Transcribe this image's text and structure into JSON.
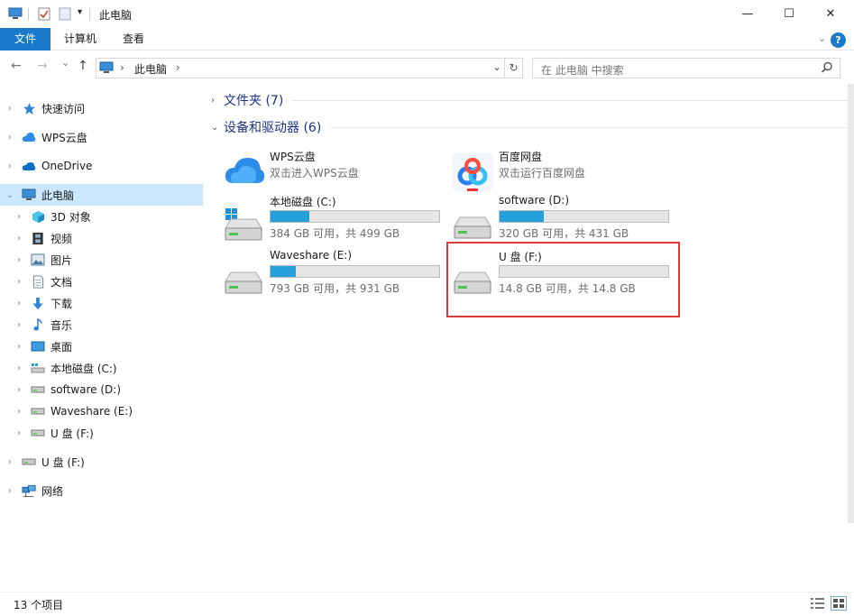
{
  "window": {
    "title": "此电脑",
    "minimize_glyph": "—",
    "maximize_glyph": "☐",
    "close_glyph": "✕"
  },
  "ribbon": {
    "tabs": [
      "文件",
      "计算机",
      "查看"
    ],
    "help": "?",
    "accent": "#1979ca"
  },
  "nav": {
    "back": "←",
    "forward": "→",
    "recent": "⌄",
    "up": "↑",
    "breadcrumb_root": "此电脑",
    "breadcrumb_sep": "›",
    "dropdown": "⌄",
    "refresh": "↻",
    "search_placeholder": "在 此电脑 中搜索"
  },
  "sidebar": {
    "items": [
      {
        "label": "快速访问",
        "icon": "star-icon",
        "chevron": "›"
      },
      {
        "label": "WPS云盘",
        "icon": "cloud-icon",
        "chevron": "›"
      },
      {
        "label": "OneDrive",
        "icon": "onedrive-icon",
        "chevron": "›"
      },
      {
        "label": "此电脑",
        "icon": "computer-icon",
        "chevron": "⌄"
      },
      {
        "label": "3D 对象",
        "icon": "cube-icon",
        "chevron": "›"
      },
      {
        "label": "视频",
        "icon": "film-icon",
        "chevron": "›"
      },
      {
        "label": "图片",
        "icon": "picture-icon",
        "chevron": "›"
      },
      {
        "label": "文档",
        "icon": "document-icon",
        "chevron": "›"
      },
      {
        "label": "下载",
        "icon": "download-icon",
        "chevron": "›"
      },
      {
        "label": "音乐",
        "icon": "music-icon",
        "chevron": "›"
      },
      {
        "label": "桌面",
        "icon": "desktop-icon",
        "chevron": "›"
      },
      {
        "label": "本地磁盘 (C:)",
        "icon": "system-drive-icon",
        "chevron": "›"
      },
      {
        "label": "software (D:)",
        "icon": "drive-icon",
        "chevron": "›"
      },
      {
        "label": "Waveshare (E:)",
        "icon": "drive-icon",
        "chevron": "›"
      },
      {
        "label": "U 盘 (F:)",
        "icon": "drive-icon",
        "chevron": "›"
      },
      {
        "label": "U 盘 (F:)",
        "icon": "drive-icon",
        "chevron": "›"
      },
      {
        "label": "网络",
        "icon": "network-icon",
        "chevron": "›"
      }
    ]
  },
  "groups": {
    "folders": {
      "label": "文件夹 (7)",
      "chevron": "›"
    },
    "devices": {
      "label": "设备和驱动器 (6)",
      "chevron": "⌄"
    }
  },
  "devices": [
    {
      "name": "WPS云盘",
      "subtitle": "双击进入WPS云盘",
      "icon": "wps-cloud-icon"
    },
    {
      "name": "百度网盘",
      "subtitle": "双击运行百度网盘",
      "icon": "baidu-netdisk-icon"
    },
    {
      "name": "本地磁盘 (C:)",
      "subtitle": "384 GB 可用，共 499 GB",
      "used_fraction": 0.23,
      "icon": "system-drive-icon"
    },
    {
      "name": "software (D:)",
      "subtitle": "320 GB 可用，共 431 GB",
      "used_fraction": 0.26,
      "icon": "drive-icon"
    },
    {
      "name": "Waveshare (E:)",
      "subtitle": "793 GB 可用，共 931 GB",
      "used_fraction": 0.15,
      "icon": "drive-icon"
    },
    {
      "name": "U 盘 (F:)",
      "subtitle": "14.8 GB 可用，共 14.8 GB",
      "used_fraction": 0.0,
      "icon": "drive-icon"
    }
  ],
  "status": {
    "count": "13 个项目"
  }
}
